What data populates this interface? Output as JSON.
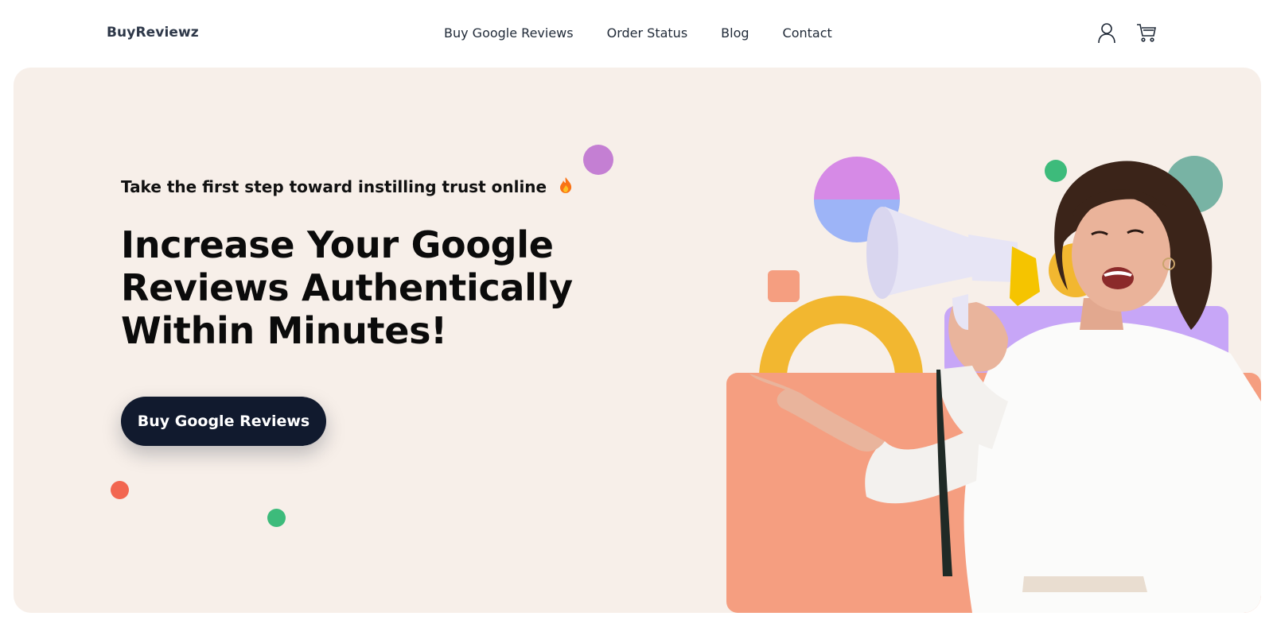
{
  "brand": {
    "name": "BuyReviewz"
  },
  "nav": {
    "items": [
      {
        "label": "Buy Google Reviews"
      },
      {
        "label": "Order Status"
      },
      {
        "label": "Blog"
      },
      {
        "label": "Contact"
      }
    ]
  },
  "header_icons": {
    "account": "user-icon",
    "cart": "cart-icon"
  },
  "hero": {
    "tagline": "Take the first step toward instilling trust online",
    "tagline_emoji": "fire-icon",
    "headline_lines": [
      "Increase Your Google",
      "Reviews Authentically",
      "Within Minutes!"
    ],
    "cta_label": "Buy Google Reviews"
  },
  "colors": {
    "hero_bg": "#f7efe9",
    "cta_bg": "#111a2e",
    "accent_coral": "#f59e80",
    "accent_yellow": "#f2b730",
    "accent_purple": "#c47fd3",
    "accent_green": "#3dbb7b",
    "accent_red": "#f26650",
    "accent_teal": "#78b3a4",
    "accent_lavender": "#c7a6f7"
  }
}
